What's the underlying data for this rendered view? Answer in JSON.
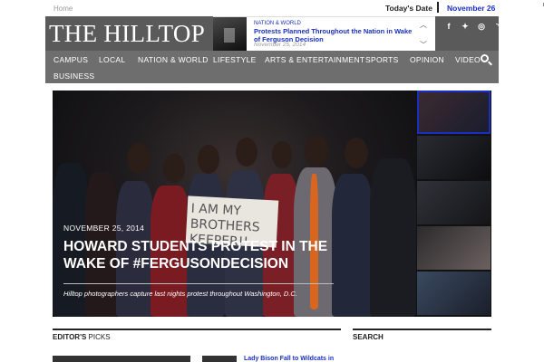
{
  "topbar": {
    "home": "Home",
    "todays_label": "Today's Date",
    "date": "November 26"
  },
  "header": {
    "logo": "THE HILLTOP",
    "ticker": {
      "category": "NATION & WORLD",
      "title": "Protests Planned Throughout the Nation in Wake of Ferguson Decision",
      "date": "November 25, 2014"
    },
    "social": [
      {
        "icon": "facebook-icon",
        "glyph": "f"
      },
      {
        "icon": "twitter-icon",
        "glyph": "🐦"
      },
      {
        "icon": "instagram-icon",
        "glyph": "◎"
      },
      {
        "icon": "rss-icon",
        "glyph": "◝"
      }
    ]
  },
  "nav": {
    "items": [
      "CAMPUS",
      "LOCAL",
      "NATION & WORLD",
      "LIFESTYLE",
      "ARTS & ENTERTAINMENT",
      "SPORTS",
      "OPINION",
      "VIDEO",
      "BUSINESS"
    ]
  },
  "hero": {
    "date": "NOVEMBER 25, 2014",
    "title": "HOWARD STUDENTS PROTEST IN THE WAKE OF #FERGUSONDECISION",
    "subtitle": "Hilltop photographers capture last nights protest throughout Washington, D.C.",
    "sign_text": "I AM MY BROTHERS KEEPER!!"
  },
  "sections": {
    "editors_picks_bold": "EDITOR'S",
    "editors_picks_rest": " PICKS",
    "search": "SEARCH"
  },
  "picks": {
    "first_title": "Lady Bison Fall to Wildcats in"
  },
  "colors": {
    "accent": "#1a2fbf",
    "header_bg": "#5a5a5a",
    "nav_bg": "#6e6e6e"
  }
}
